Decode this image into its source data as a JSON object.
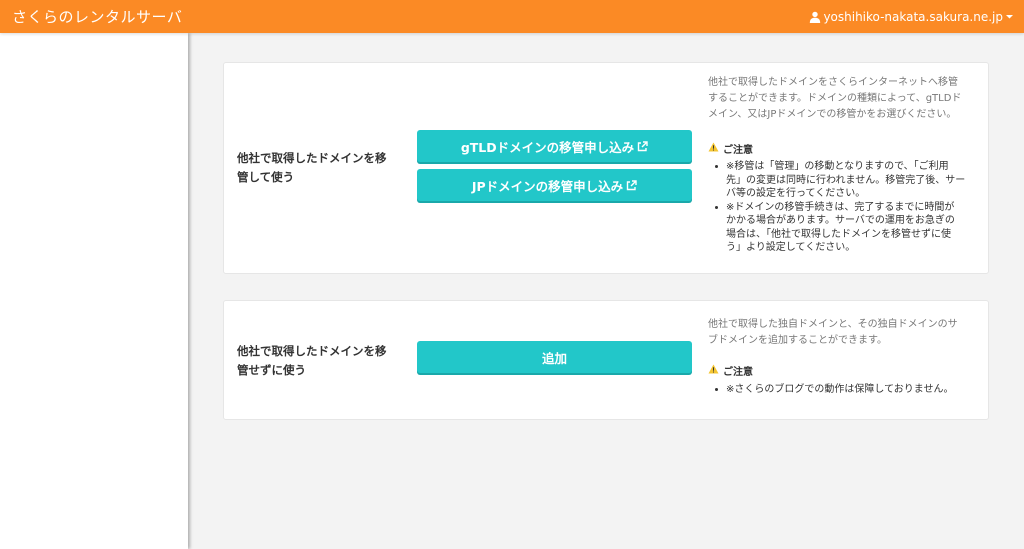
{
  "header": {
    "brand": "さくらのレンタルサーバ",
    "user": "yoshihiko-nakata.sakura.ne.jp",
    "user_icon": "user-icon",
    "dropdown_icon": "caret-down-icon"
  },
  "colors": {
    "header_bg": "#fb8a25",
    "button_bg": "#22c7c9",
    "warning": "#f4c531"
  },
  "transfer": {
    "label_line1": "他社で取得したドメインを移",
    "label_line2": "管して使う",
    "gtld_button": "gTLDドメインの移管申し込み",
    "jp_button": "JPドメインの移管申し込み",
    "external_icon": "external-link-icon",
    "desc_line1": "他社で取得したドメインをさくらインターネットへ移管",
    "desc_line2": "することができます。ドメインの種類によって、gTLDド",
    "desc_line3": "メイン、又はJPドメインでの移管かをお選びください。",
    "notice_title": "ご注意",
    "notice_icon": "warning-icon",
    "note1_line1": "※移管は「管理」の移動となりますので、「ご利用",
    "note1_line2": "先」の変更は同時に行われません。移管完了後、サー",
    "note1_line3": "バ等の設定を行ってください。",
    "note2_line1": "※ドメインの移管手続きは、完了するまでに時間が",
    "note2_line2": "かかる場合があります。サーバでの運用をお急ぎの",
    "note2_line3": "場合は、「他社で取得したドメインを移管せずに使",
    "note2_line4": "う」より設定してください。"
  },
  "no_transfer": {
    "label_line1": "他社で取得したドメインを移",
    "label_line2": "管せずに使う",
    "add_button": "追加",
    "desc_line1": "他社で取得した独自ドメインと、その独自ドメインのサ",
    "desc_line2": "ブドメインを追加することができます。",
    "notice_title": "ご注意",
    "notice_icon": "warning-icon",
    "note1": "※さくらのブログでの動作は保障しておりません。"
  }
}
